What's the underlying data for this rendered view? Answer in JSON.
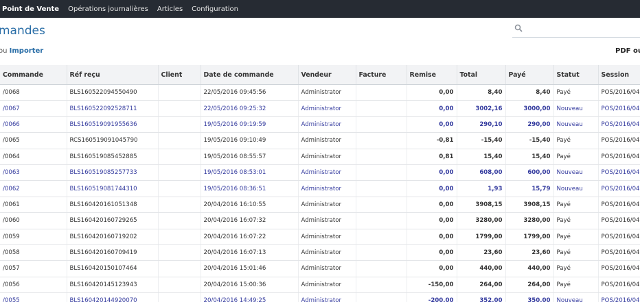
{
  "topbar": {
    "items": [
      "Point de Vente",
      "Opérations journalières",
      "Articles",
      "Configuration"
    ]
  },
  "page": {
    "title": "mandes",
    "or_text": "ou ",
    "import_label": "Importer",
    "export_label": "PDF ou"
  },
  "table": {
    "columns": [
      "Commande",
      "Réf reçu",
      "Client",
      "Date de commande",
      "Vendeur",
      "Facture",
      "Remise",
      "Total",
      "Payé",
      "Statut",
      "Session"
    ],
    "rows": [
      {
        "commande": "/0068",
        "ref": "BLS160522094550490",
        "client": "",
        "date": "22/05/2016 09:45:56",
        "vendeur": "Administrator",
        "facture": "",
        "remise": "0,00",
        "total": "8,40",
        "paye": "8,40",
        "statut": "Payé",
        "session": "POS/2016/04",
        "new": false
      },
      {
        "commande": "/0067",
        "ref": "BLS160522092528711",
        "client": "",
        "date": "22/05/2016 09:25:32",
        "vendeur": "Administrator",
        "facture": "",
        "remise": "0,00",
        "total": "3002,16",
        "paye": "3000,00",
        "statut": "Nouveau",
        "session": "POS/2016/04",
        "new": true
      },
      {
        "commande": "/0066",
        "ref": "BLS160519091955636",
        "client": "",
        "date": "19/05/2016 09:19:59",
        "vendeur": "Administrator",
        "facture": "",
        "remise": "0,00",
        "total": "290,10",
        "paye": "290,00",
        "statut": "Nouveau",
        "session": "POS/2016/04",
        "new": true
      },
      {
        "commande": "/0065",
        "ref": "RCS160519091045790",
        "client": "",
        "date": "19/05/2016 09:10:49",
        "vendeur": "Administrator",
        "facture": "",
        "remise": "-0,81",
        "total": "-15,40",
        "paye": "-15,40",
        "statut": "Payé",
        "session": "POS/2016/04",
        "new": false
      },
      {
        "commande": "/0064",
        "ref": "BLS160519085452885",
        "client": "",
        "date": "19/05/2016 08:55:57",
        "vendeur": "Administrator",
        "facture": "",
        "remise": "0,81",
        "total": "15,40",
        "paye": "15,40",
        "statut": "Payé",
        "session": "POS/2016/04",
        "new": false
      },
      {
        "commande": "/0063",
        "ref": "BLS160519085257733",
        "client": "",
        "date": "19/05/2016 08:53:01",
        "vendeur": "Administrator",
        "facture": "",
        "remise": "0,00",
        "total": "608,00",
        "paye": "600,00",
        "statut": "Nouveau",
        "session": "POS/2016/04",
        "new": true
      },
      {
        "commande": "/0062",
        "ref": "BLS160519081744310",
        "client": "",
        "date": "19/05/2016 08:36:51",
        "vendeur": "Administrator",
        "facture": "",
        "remise": "0,00",
        "total": "1,93",
        "paye": "15,79",
        "statut": "Nouveau",
        "session": "POS/2016/04",
        "new": true
      },
      {
        "commande": "/0061",
        "ref": "BLS160420161051348",
        "client": "",
        "date": "20/04/2016 16:10:55",
        "vendeur": "Administrator",
        "facture": "",
        "remise": "0,00",
        "total": "3908,15",
        "paye": "3908,15",
        "statut": "Payé",
        "session": "POS/2016/04",
        "new": false
      },
      {
        "commande": "/0060",
        "ref": "BLS160420160729265",
        "client": "",
        "date": "20/04/2016 16:07:32",
        "vendeur": "Administrator",
        "facture": "",
        "remise": "0,00",
        "total": "3280,00",
        "paye": "3280,00",
        "statut": "Payé",
        "session": "POS/2016/04",
        "new": false
      },
      {
        "commande": "/0059",
        "ref": "BLS160420160719202",
        "client": "",
        "date": "20/04/2016 16:07:22",
        "vendeur": "Administrator",
        "facture": "",
        "remise": "0,00",
        "total": "1799,00",
        "paye": "1799,00",
        "statut": "Payé",
        "session": "POS/2016/04",
        "new": false
      },
      {
        "commande": "/0058",
        "ref": "BLS160420160709419",
        "client": "",
        "date": "20/04/2016 16:07:13",
        "vendeur": "Administrator",
        "facture": "",
        "remise": "0,00",
        "total": "23,60",
        "paye": "23,60",
        "statut": "Payé",
        "session": "POS/2016/04",
        "new": false
      },
      {
        "commande": "/0057",
        "ref": "BLS160420150107464",
        "client": "",
        "date": "20/04/2016 15:01:46",
        "vendeur": "Administrator",
        "facture": "",
        "remise": "0,00",
        "total": "440,00",
        "paye": "440,00",
        "statut": "Payé",
        "session": "POS/2016/04",
        "new": false
      },
      {
        "commande": "/0056",
        "ref": "BLS160420145123943",
        "client": "",
        "date": "20/04/2016 15:00:36",
        "vendeur": "Administrator",
        "facture": "",
        "remise": "-150,00",
        "total": "264,00",
        "paye": "264,00",
        "statut": "Payé",
        "session": "POS/2016/04",
        "new": false
      },
      {
        "commande": "/0055",
        "ref": "BLS160420144920070",
        "client": "",
        "date": "20/04/2016 14:49:25",
        "vendeur": "Administrator",
        "facture": "",
        "remise": "-200,00",
        "total": "352,00",
        "paye": "350,00",
        "statut": "Nouveau",
        "session": "POS/2016/04",
        "new": true
      }
    ]
  },
  "colors": {
    "topbar_bg": "#262b33",
    "accent": "#2a6ea7",
    "new_row_text": "#333a9e"
  }
}
